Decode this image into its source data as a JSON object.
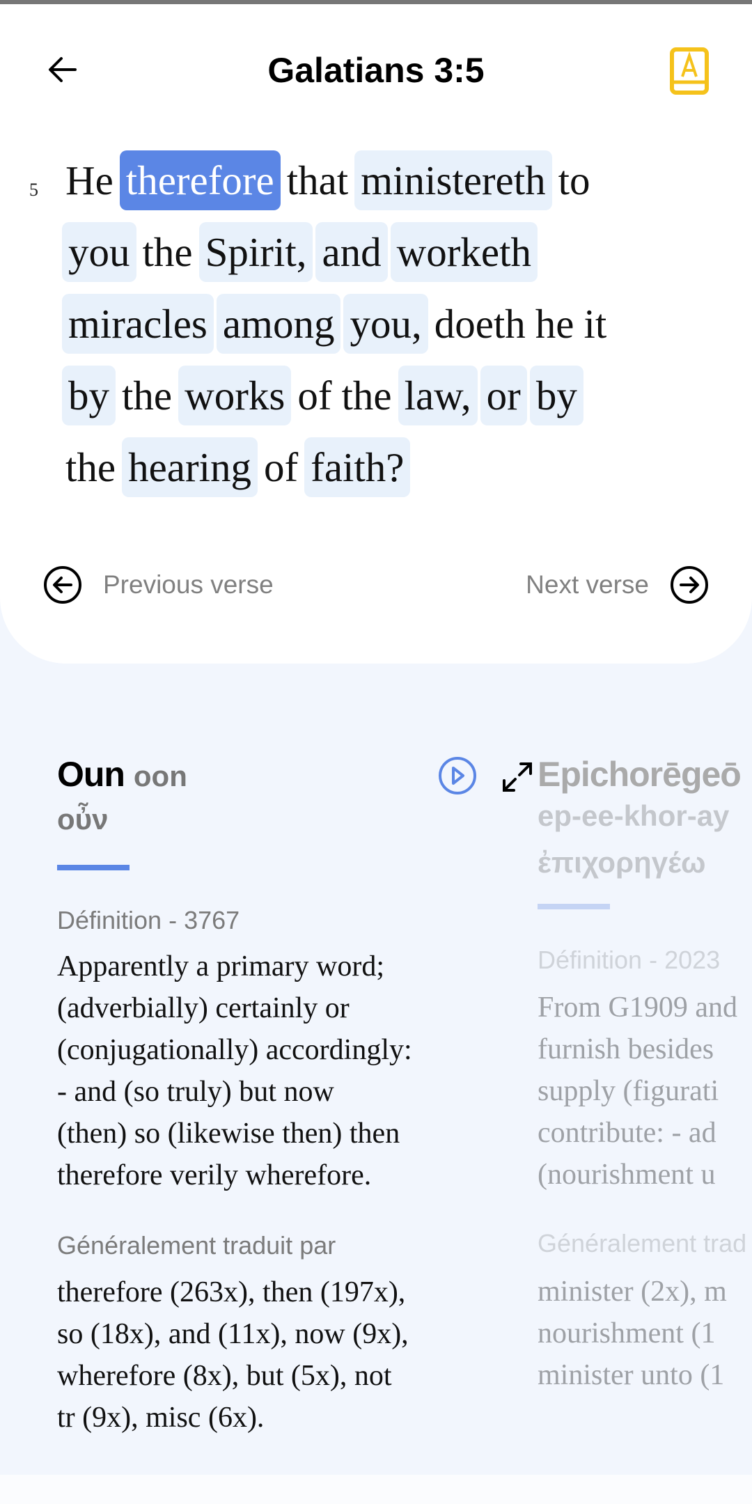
{
  "header": {
    "title": "Galatians 3:5",
    "back_icon": "arrow-left-icon",
    "dictionary_icon": "book-letter-a-icon",
    "accent": "#f5c21b"
  },
  "verse": {
    "number": "5",
    "selected_color": "#5b86e5",
    "chip_color": "#e8f1fb",
    "lines": [
      [
        {
          "t": "He",
          "k": "plain"
        },
        {
          "t": "therefore",
          "k": "sel"
        },
        {
          "t": "that",
          "k": "plain"
        },
        {
          "t": "ministereth",
          "k": "chip"
        },
        {
          "t": "to",
          "k": "plain"
        }
      ],
      [
        {
          "t": "you",
          "k": "chip"
        },
        {
          "t": "the",
          "k": "plain"
        },
        {
          "t": "Spirit,",
          "k": "chip"
        },
        {
          "t": "and",
          "k": "chip"
        },
        {
          "t": "worketh",
          "k": "chip"
        }
      ],
      [
        {
          "t": "miracles",
          "k": "chip"
        },
        {
          "t": "among",
          "k": "chip"
        },
        {
          "t": "you,",
          "k": "chip"
        },
        {
          "t": "doeth",
          "k": "plain"
        },
        {
          "t": "he",
          "k": "plain"
        },
        {
          "t": "it",
          "k": "plain"
        }
      ],
      [
        {
          "t": "by",
          "k": "chip"
        },
        {
          "t": "the",
          "k": "plain"
        },
        {
          "t": "works",
          "k": "chip"
        },
        {
          "t": "of",
          "k": "plain"
        },
        {
          "t": "the",
          "k": "plain"
        },
        {
          "t": "law,",
          "k": "chip"
        },
        {
          "t": "or",
          "k": "chip"
        },
        {
          "t": "by",
          "k": "chip"
        }
      ],
      [
        {
          "t": "the",
          "k": "plain"
        },
        {
          "t": "hearing",
          "k": "chip"
        },
        {
          "t": "of",
          "k": "plain"
        },
        {
          "t": "faith?",
          "k": "chip"
        }
      ]
    ]
  },
  "nav": {
    "previous": "Previous verse",
    "next": "Next verse"
  },
  "cards": [
    {
      "word": "Oun",
      "pron": "oon",
      "greek": "οὖν",
      "def_label": "Définition - 3767",
      "definition": [
        "Apparently a primary word;",
        "(adverbially) certainly or",
        "(conjugationally) accordingly:",
        "- and (so truly) but now",
        "(then) so (likewise then) then",
        "therefore verily wherefore."
      ],
      "trans_label": "Généralement traduit par",
      "translations": [
        "therefore (263x), then (197x),",
        "so (18x), and (11x), now (9x),",
        "wherefore (8x), but (5x), not",
        "tr (9x), misc (6x)."
      ]
    },
    {
      "word": "Epichorēgeō",
      "pron": "ep-ee-khor-ay",
      "greek": "ἐπιχορηγέω",
      "def_label": "Définition - 2023",
      "definition": [
        "From G1909 and",
        "furnish besides",
        "supply (figurati",
        "contribute:  - ad",
        "(nourishment u"
      ],
      "trans_label": "Généralement trad",
      "translations": [
        "minister (2x), m",
        "nourishment (1",
        "minister unto (1"
      ]
    }
  ]
}
